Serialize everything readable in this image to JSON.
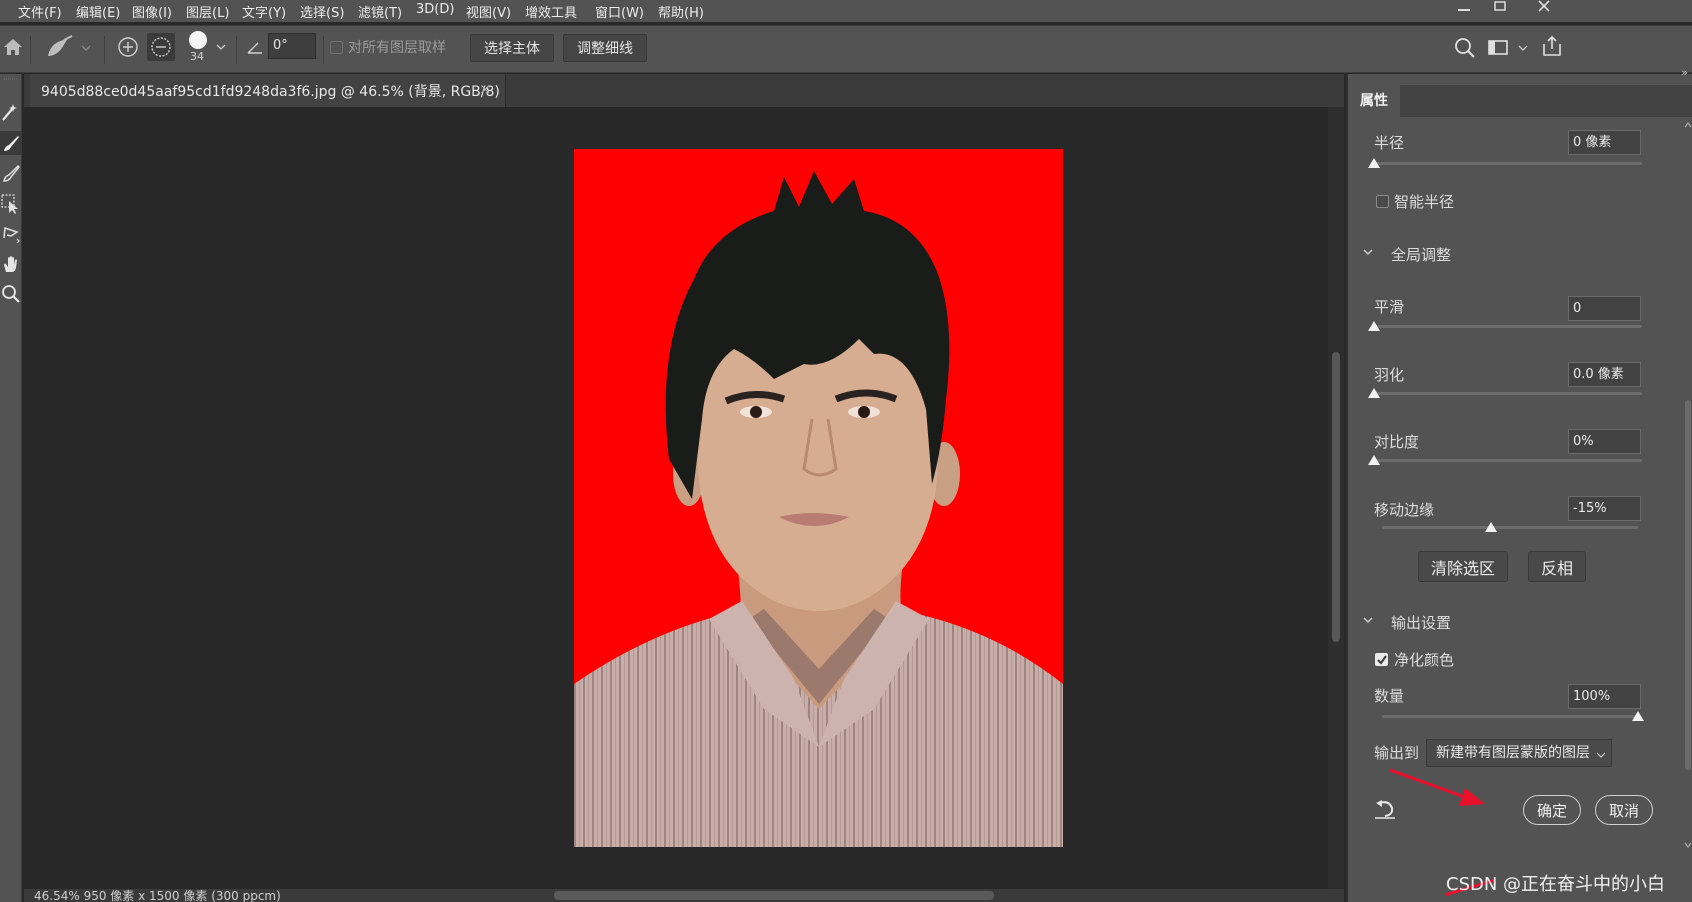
{
  "menu": [
    "文件(F)",
    "编辑(E)",
    "图像(I)",
    "图层(L)",
    "文字(Y)",
    "选择(S)",
    "滤镜(T)",
    "3D(D)",
    "视图(V)",
    "增效工具",
    "窗口(W)",
    "帮助(H)"
  ],
  "options": {
    "brush_size": "34",
    "angle": "0°",
    "sample_all_layers": "对所有图层取样",
    "select_subject": "选择主体",
    "refine_hair": "调整细线"
  },
  "document": {
    "tab_title": "9405d88ce0d45aaf95cd1fd9248da3f6.jpg @ 46.5% (背景, RGB/8)",
    "photo_background": "#ff0000",
    "status": "46.54%   950 像素 x 1500 像素 (300 ppcm)"
  },
  "panel": {
    "tab": "属性",
    "radius": {
      "label": "半径",
      "value": "0 像素",
      "level": 0
    },
    "smart_radius": "智能半径",
    "global_section": "全局调整",
    "smooth": {
      "label": "平滑",
      "value": "0",
      "level": 0
    },
    "feather": {
      "label": "羽化",
      "value": "0.0 像素",
      "level": 0
    },
    "contrast": {
      "label": "对比度",
      "value": "0%",
      "level": 0
    },
    "shift_edge": {
      "label": "移动边缘",
      "value": "-15%",
      "level": 0.425
    },
    "clear_selection": "清除选区",
    "invert": "反相",
    "output_section": "输出设置",
    "decontaminate": "净化颜色",
    "amount": {
      "label": "数量",
      "value": "100%",
      "level": 1
    },
    "output_to_label": "输出到",
    "output_to_value": "新建带有图层蒙版的图层",
    "ok": "确定",
    "cancel": "取消"
  },
  "watermark": "CSDN @正在奋斗中的小白",
  "colors": {
    "menubar": "#535353",
    "canvas": "#282828",
    "photo_bg": "#ff0000",
    "arrow": "#e8102a"
  }
}
